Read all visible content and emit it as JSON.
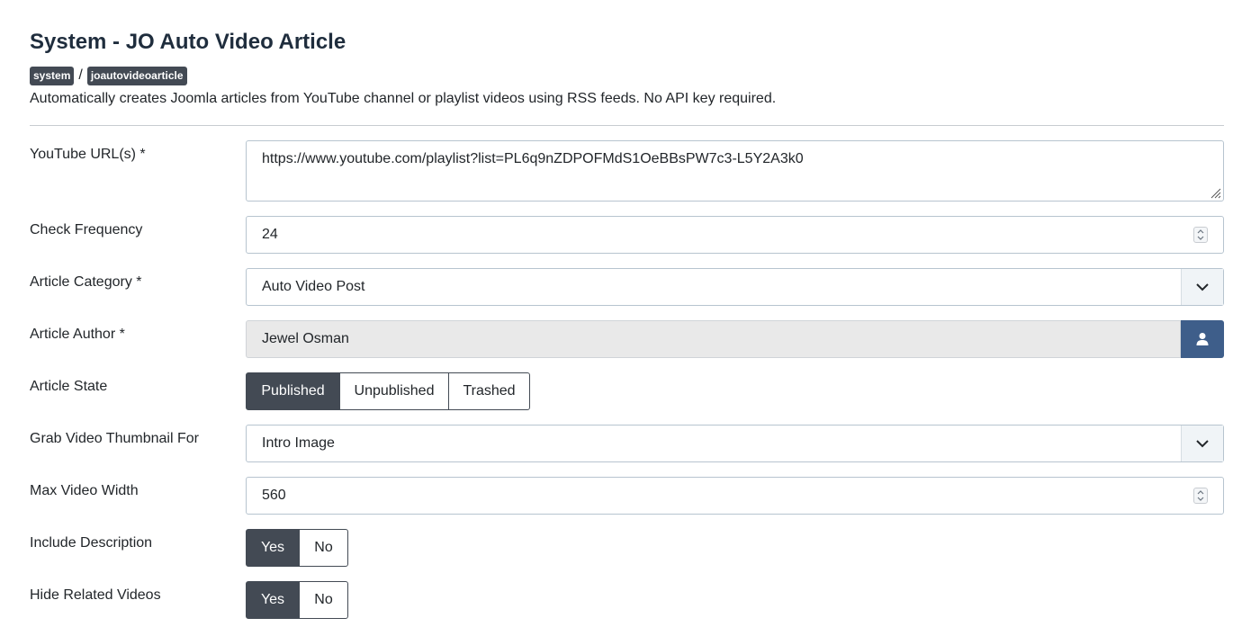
{
  "header": {
    "title": "System - JO Auto Video Article",
    "crumbs": [
      "system",
      "joautovideoarticle"
    ],
    "separator": "/",
    "description": "Automatically creates Joomla articles from YouTube channel or playlist videos using RSS feeds. No API key required."
  },
  "fields": {
    "youtube_urls": {
      "label": "YouTube URL(s) *",
      "value": "https://www.youtube.com/playlist?list=PL6q9nZDPOFMdS1OeBBsPW7c3-L5Y2A3k0"
    },
    "check_frequency": {
      "label": "Check Frequency",
      "value": "24"
    },
    "article_category": {
      "label": "Article Category *",
      "value": "Auto Video Post"
    },
    "article_author": {
      "label": "Article Author *",
      "value": "Jewel Osman"
    },
    "article_state": {
      "label": "Article State",
      "options": [
        "Published",
        "Unpublished",
        "Trashed"
      ],
      "selected": "Published"
    },
    "thumbnail_for": {
      "label": "Grab Video Thumbnail For",
      "value": "Intro Image"
    },
    "max_video_width": {
      "label": "Max Video Width",
      "value": "560"
    },
    "include_description": {
      "label": "Include Description",
      "options": [
        "Yes",
        "No"
      ],
      "selected": "Yes"
    },
    "hide_related": {
      "label": "Hide Related Videos",
      "options": [
        "Yes",
        "No"
      ],
      "selected": "Yes"
    }
  },
  "icons": {
    "spinner": "up-down-arrows-icon",
    "select": "chevron-down-icon",
    "author_button": "user-icon",
    "resize": "resize-handle-icon"
  },
  "colors": {
    "active_button": "#434a54",
    "author_button": "#3e5e8a",
    "readonly_bg": "#e9e9e9",
    "border": "#b7c4cf"
  }
}
